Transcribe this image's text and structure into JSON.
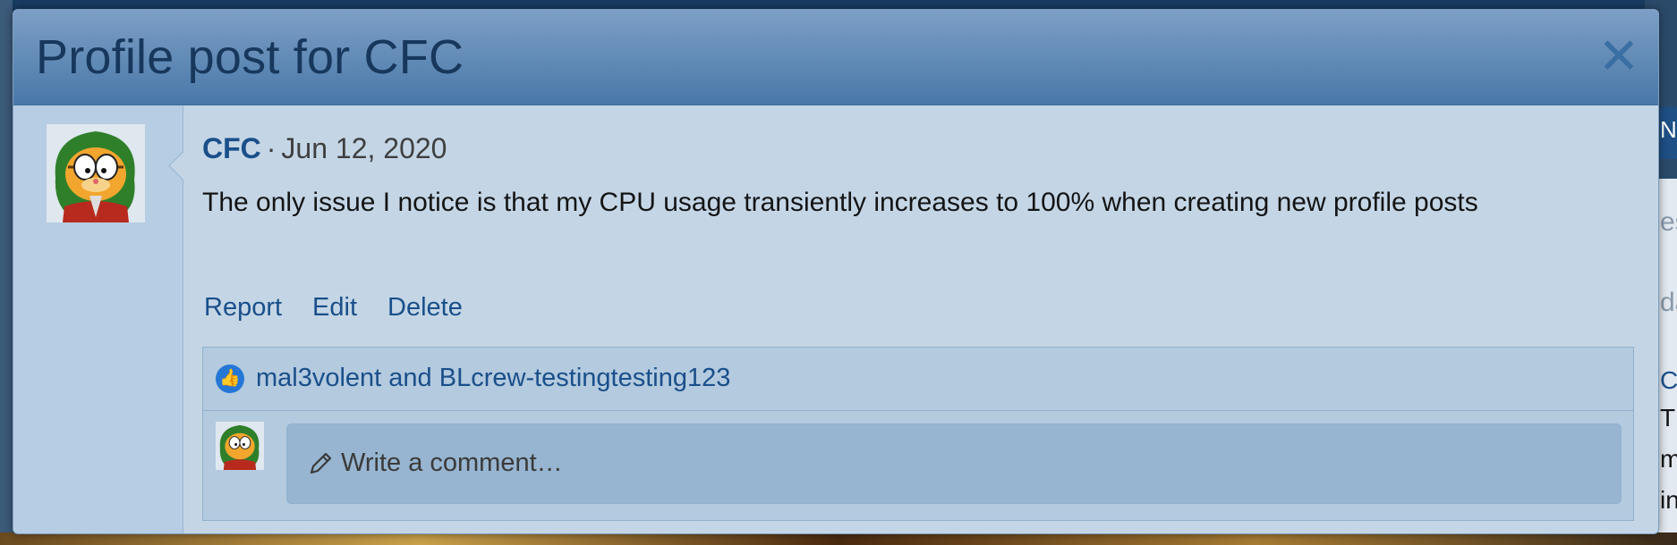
{
  "modal": {
    "title": "Profile post for CFC",
    "close_icon": "close-icon"
  },
  "post": {
    "author": "CFC",
    "separator": "·",
    "date": "Jun 12, 2020",
    "message": "The only issue I notice is that my CPU usage transiently increases to 100% when creating new profile posts",
    "actions": {
      "report": "Report",
      "edit": "Edit",
      "delete": "Delete"
    },
    "likes": {
      "icon": "thumbs-up-icon",
      "text": "mal3volent and BLcrew-testingtesting123"
    },
    "comment": {
      "placeholder": "Write a comment…",
      "icon": "pencil-icon"
    }
  },
  "background": {
    "right_text_lines": [
      "N",
      "es",
      "da",
      "C",
      "T",
      "m",
      "in"
    ]
  },
  "colors": {
    "header_top": "#7d9fc6",
    "header_bottom": "#4978a8",
    "title": "#17375c",
    "link": "#1a4f8a",
    "body_bg": "#c4d6e6",
    "like_icon": "#2577d6"
  }
}
